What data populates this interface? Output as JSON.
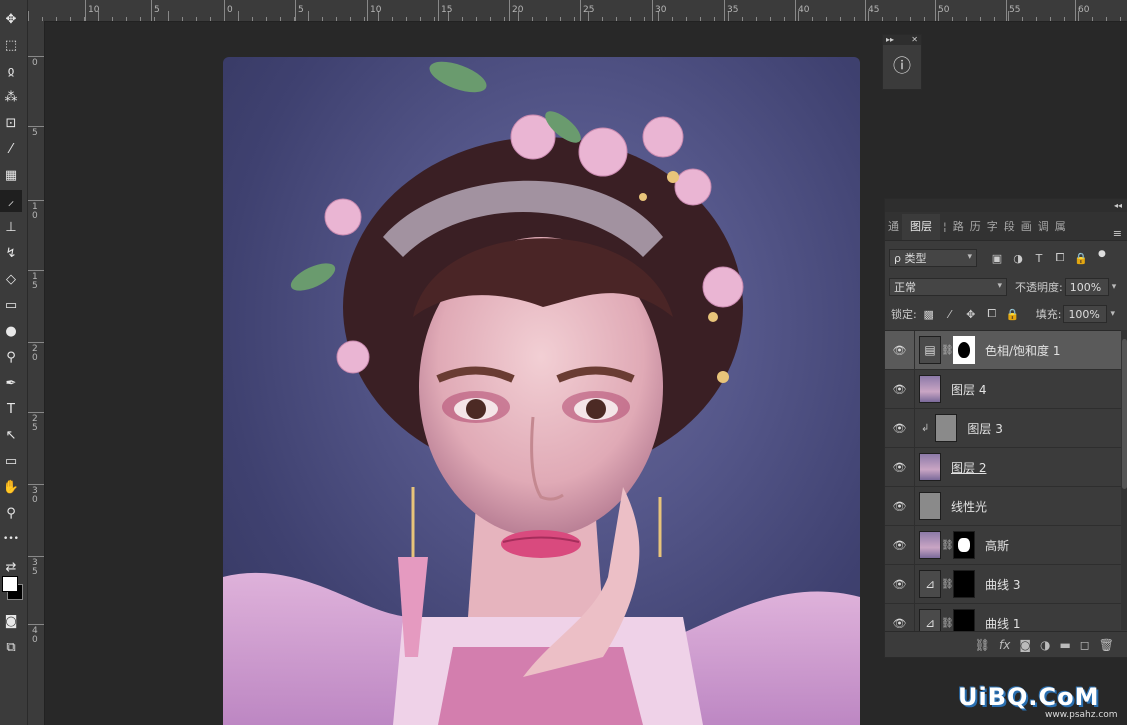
{
  "toolbar": {
    "tools": [
      {
        "name": "move-tool-icon",
        "glyph": "✥"
      },
      {
        "name": "marquee-tool-icon",
        "glyph": "⬚"
      },
      {
        "name": "lasso-tool-icon",
        "glyph": "ჲ"
      },
      {
        "name": "magic-wand-tool-icon",
        "glyph": "⁂"
      },
      {
        "name": "crop-tool-icon",
        "glyph": "⊡"
      },
      {
        "name": "eyedropper-tool-icon",
        "glyph": "⁄"
      },
      {
        "name": "healing-brush-tool-icon",
        "glyph": "▦"
      },
      {
        "name": "brush-tool-icon",
        "glyph": "⸝"
      },
      {
        "name": "clone-stamp-tool-icon",
        "glyph": "⊥"
      },
      {
        "name": "history-brush-tool-icon",
        "glyph": "↯"
      },
      {
        "name": "eraser-tool-icon",
        "glyph": "◇"
      },
      {
        "name": "gradient-tool-icon",
        "glyph": "▭"
      },
      {
        "name": "blur-tool-icon",
        "glyph": "●"
      },
      {
        "name": "dodge-tool-icon",
        "glyph": "⚲"
      },
      {
        "name": "pen-tool-icon",
        "glyph": "✒"
      },
      {
        "name": "type-tool-icon",
        "glyph": "T"
      },
      {
        "name": "path-selection-tool-icon",
        "glyph": "↖"
      },
      {
        "name": "rectangle-tool-icon",
        "glyph": "▭"
      },
      {
        "name": "hand-tool-icon",
        "glyph": "✋"
      },
      {
        "name": "zoom-tool-icon",
        "glyph": "⚲"
      },
      {
        "name": "more-tools-icon",
        "glyph": "•••"
      },
      {
        "name": "swap-colors-icon",
        "glyph": "⇄"
      },
      {
        "name": "quick-mask-icon",
        "glyph": "◙"
      },
      {
        "name": "screen-mode-icon",
        "glyph": "⧉"
      }
    ]
  },
  "ruler": {
    "top_labels": [
      "10",
      "5",
      "0",
      "5",
      "10",
      "15",
      "20",
      "25",
      "30",
      "35",
      "40",
      "45",
      "50",
      "55",
      "60"
    ],
    "left_labels": [
      "0",
      "5",
      "1\n0",
      "1\n5",
      "2\n0",
      "2\n5",
      "3\n0",
      "3\n5",
      "4\n0"
    ]
  },
  "mini_panel": {
    "icon": "info-icon",
    "glyph": "ⓘ",
    "collapse": "▸▸",
    "close": "✕"
  },
  "layers_panel": {
    "strip": "◂◂",
    "tabs": [
      "通",
      "图层",
      "¦",
      "路",
      "历",
      "字",
      "段",
      "画",
      "调",
      "属"
    ],
    "active_tab": "图层",
    "filter": {
      "label": "ρ 类型",
      "icons": [
        "▣",
        "◑",
        "T",
        "⧠",
        "🔒"
      ]
    },
    "blend_mode": "正常",
    "opacity_label": "不透明度:",
    "opacity_value": "100%",
    "lock_label": "锁定:",
    "lock_icons": [
      "▩",
      "⁄",
      "✥",
      "⧠",
      "🔒"
    ],
    "fill_label": "填充:",
    "fill_value": "100%",
    "layers": [
      {
        "name": "色相/饱和度 1",
        "kind": "adjustment",
        "selected": true,
        "mask": true
      },
      {
        "name": "图层 4",
        "kind": "photo",
        "selected": false,
        "mask": false
      },
      {
        "name": "图层 3",
        "kind": "grey",
        "selected": false,
        "mask": false,
        "clipped": true
      },
      {
        "name": "图层 2",
        "kind": "photo",
        "selected": false,
        "mask": false,
        "underline": true
      },
      {
        "name": "线性光",
        "kind": "grey",
        "selected": false,
        "mask": false
      },
      {
        "name": "高斯",
        "kind": "photo",
        "selected": false,
        "mask": true
      },
      {
        "name": "曲线 3",
        "kind": "curves",
        "selected": false,
        "mask": true
      },
      {
        "name": "曲线 1",
        "kind": "curves",
        "selected": false,
        "mask": true
      }
    ],
    "bottom_icons": [
      "⛓",
      "fx",
      "◙",
      "◑",
      "▬",
      "◻",
      "🗑"
    ]
  },
  "watermark": {
    "text": "UiBQ.CoM",
    "sub": "www.psahz.com"
  }
}
